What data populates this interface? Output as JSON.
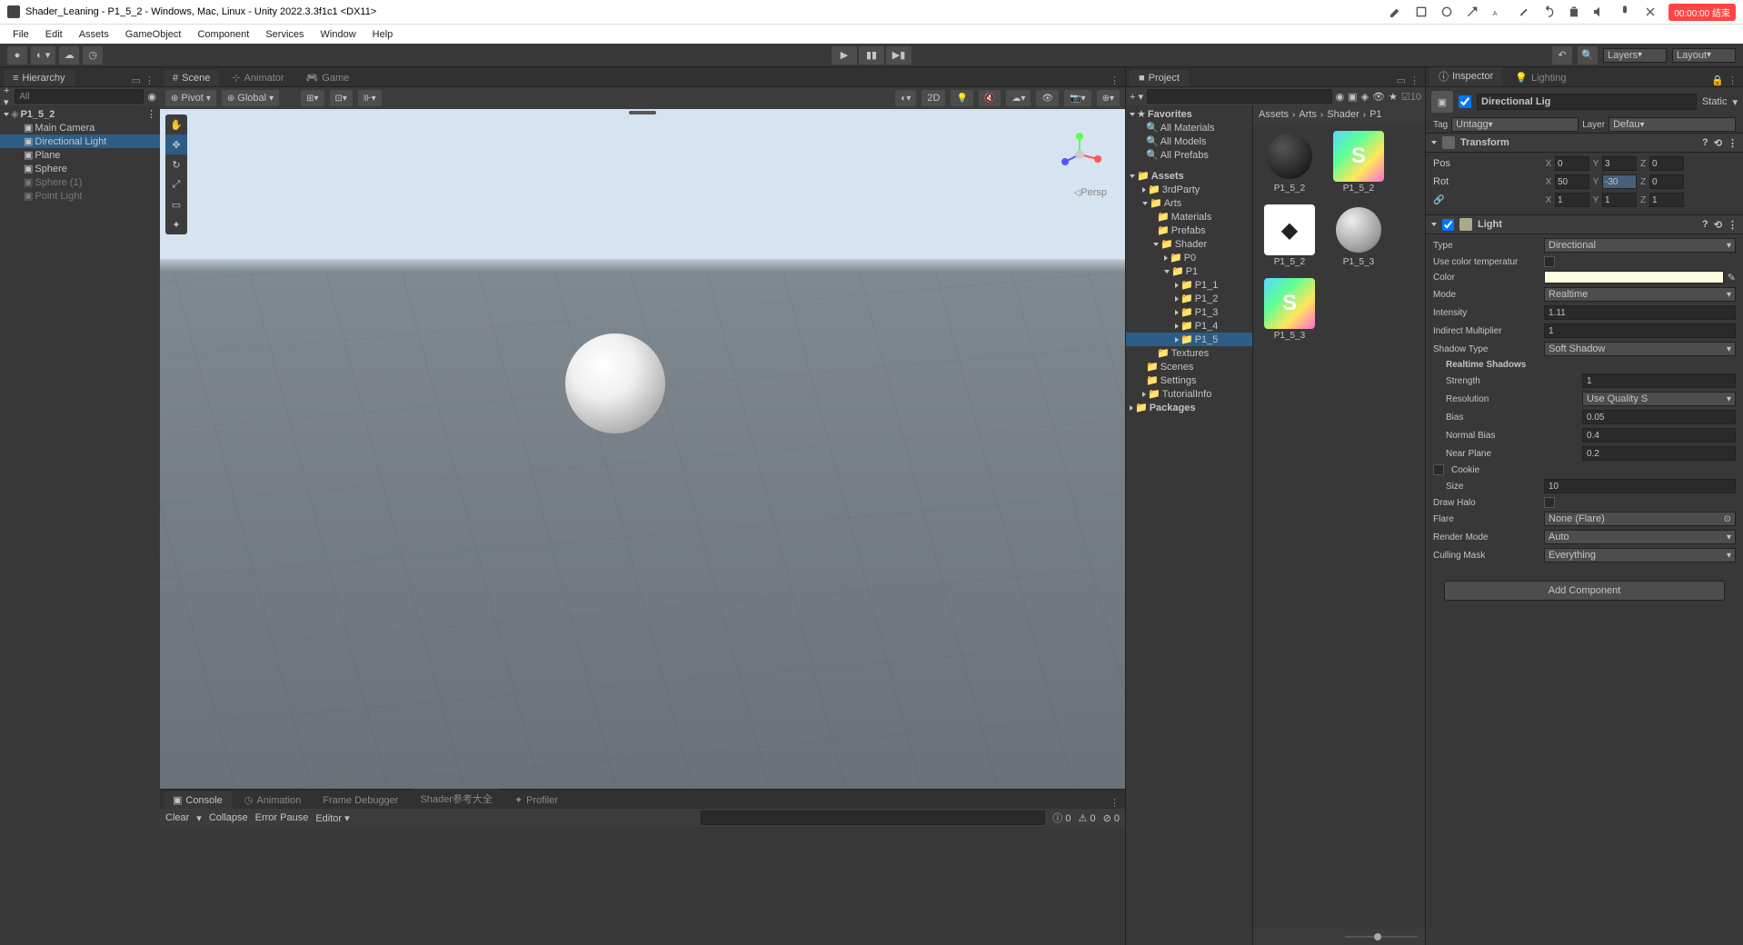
{
  "title": "Shader_Leaning - P1_5_2 - Windows, Mac, Linux - Unity 2022.3.3f1c1 <DX11>",
  "rec": "00:00:00 结束",
  "menu": [
    "File",
    "Edit",
    "Assets",
    "GameObject",
    "Component",
    "Services",
    "Window",
    "Help"
  ],
  "layers": "Layers",
  "layout": "Layout",
  "hierarchy": {
    "title": "Hierarchy",
    "search": "All",
    "scene": "P1_5_2",
    "items": [
      "Main Camera",
      "Directional Light",
      "Plane",
      "Sphere",
      "Sphere (1)",
      "Point Light"
    ]
  },
  "scene": {
    "tabs": [
      "Scene",
      "Animator",
      "Game"
    ],
    "pivot": "Pivot",
    "global": "Global",
    "mode2d": "2D",
    "persp": "Persp"
  },
  "console": {
    "tabs": [
      "Console",
      "Animation",
      "Frame Debugger",
      "Shader参考大全",
      "Profiler"
    ],
    "clear": "Clear",
    "collapse": "Collapse",
    "errorpause": "Error Pause",
    "editor": "Editor",
    "c0": "0",
    "c1": "0",
    "c2": "0"
  },
  "project": {
    "title": "Project",
    "count": "10",
    "favorites": "Favorites",
    "favitems": [
      "All Materials",
      "All Models",
      "All Prefabs"
    ],
    "assets": "Assets",
    "folders": [
      "3rdParty",
      "Arts"
    ],
    "arts_sub": [
      "Materials",
      "Prefabs",
      "Shader"
    ],
    "shader_sub": [
      "P0",
      "P1"
    ],
    "p1_sub": [
      "P1_1",
      "P1_2",
      "P1_3",
      "P1_4",
      "P1_5"
    ],
    "more": [
      "Textures",
      "Scenes",
      "Settings",
      "TutorialInfo"
    ],
    "packages": "Packages",
    "breadcrumb": [
      "Assets",
      "Arts",
      "Shader",
      "P1"
    ],
    "items": [
      {
        "name": "P1_5_2",
        "type": "sphere-dark"
      },
      {
        "name": "P1_5_2",
        "type": "shader"
      },
      {
        "name": "P1_5_2",
        "type": "unity"
      },
      {
        "name": "P1_5_3",
        "type": "sphere"
      },
      {
        "name": "P1_5_3",
        "type": "shader"
      }
    ]
  },
  "inspector": {
    "title": "Inspector",
    "lighting": "Lighting",
    "objname": "Directional Lig",
    "static": "Static",
    "tag": "Tag",
    "tagv": "Untagg",
    "layer": "Layer",
    "layerv": "Defau",
    "transform": {
      "title": "Transform",
      "pos": "Pos",
      "rot": "Rot",
      "scl": "",
      "px": "0",
      "py": "3",
      "pz": "0",
      "rx": "50",
      "ry": "-30",
      "rz": "0",
      "sx": "1",
      "sy": "1",
      "sz": "1",
      "X": "X",
      "Y": "Y",
      "Z": "Z"
    },
    "light": {
      "title": "Light",
      "type": "Type",
      "typev": "Directional",
      "usecolor": "Use color temperatur",
      "color": "Color",
      "mode": "Mode",
      "modev": "Realtime",
      "intensity": "Intensity",
      "intensityv": "1.11",
      "indmult": "Indirect Multiplier",
      "indmultv": "1",
      "shadowtype": "Shadow Type",
      "shadowtypev": "Soft Shadow",
      "realtime": "Realtime Shadows",
      "strength": "Strength",
      "strengthv": "1",
      "resolution": "Resolution",
      "resolutionv": "Use Quality S",
      "bias": "Bias",
      "biasv": "0.05",
      "normalbias": "Normal Bias",
      "normalbiasv": "0.4",
      "nearplane": "Near Plane",
      "nearplanev": "0.2",
      "cookie": "Cookie",
      "size": "Size",
      "sizev": "10",
      "drawhalo": "Draw Halo",
      "flare": "Flare",
      "flarev": "None (Flare)",
      "rendermode": "Render Mode",
      "rendermodev": "Auto",
      "cullingmask": "Culling Mask",
      "cullingmaskv": "Everything"
    },
    "addcomp": "Add Component"
  }
}
